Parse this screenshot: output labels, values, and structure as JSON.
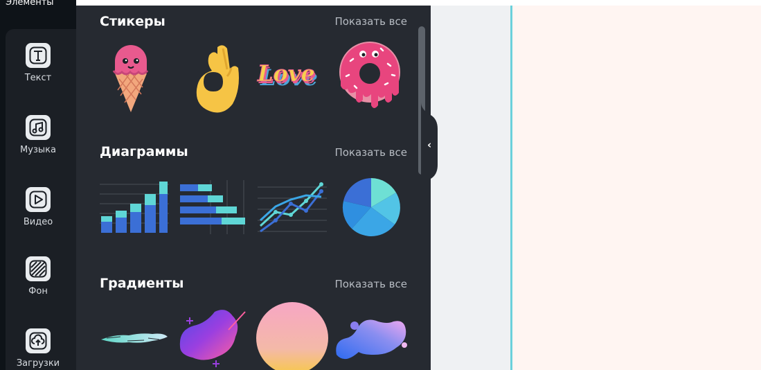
{
  "rail": {
    "top_label": "Элементы",
    "items": [
      {
        "label": "Текст",
        "icon": "text-icon"
      },
      {
        "label": "Музыка",
        "icon": "music-icon"
      },
      {
        "label": "Видео",
        "icon": "video-icon"
      },
      {
        "label": "Фон",
        "icon": "background-icon"
      },
      {
        "label": "Загрузки",
        "icon": "upload-icon"
      }
    ]
  },
  "sections": {
    "stickers": {
      "title": "Стикеры",
      "show_all": "Показать все"
    },
    "charts": {
      "title": "Диаграммы",
      "show_all": "Показать все"
    },
    "gradients": {
      "title": "Градиенты",
      "show_all": "Показать все"
    }
  },
  "sticker_text": "Love",
  "colors": {
    "panel": "#262a31",
    "rail": "#0e1318",
    "canvas_page": "#fff5f2",
    "guide": "#6bd0db"
  }
}
